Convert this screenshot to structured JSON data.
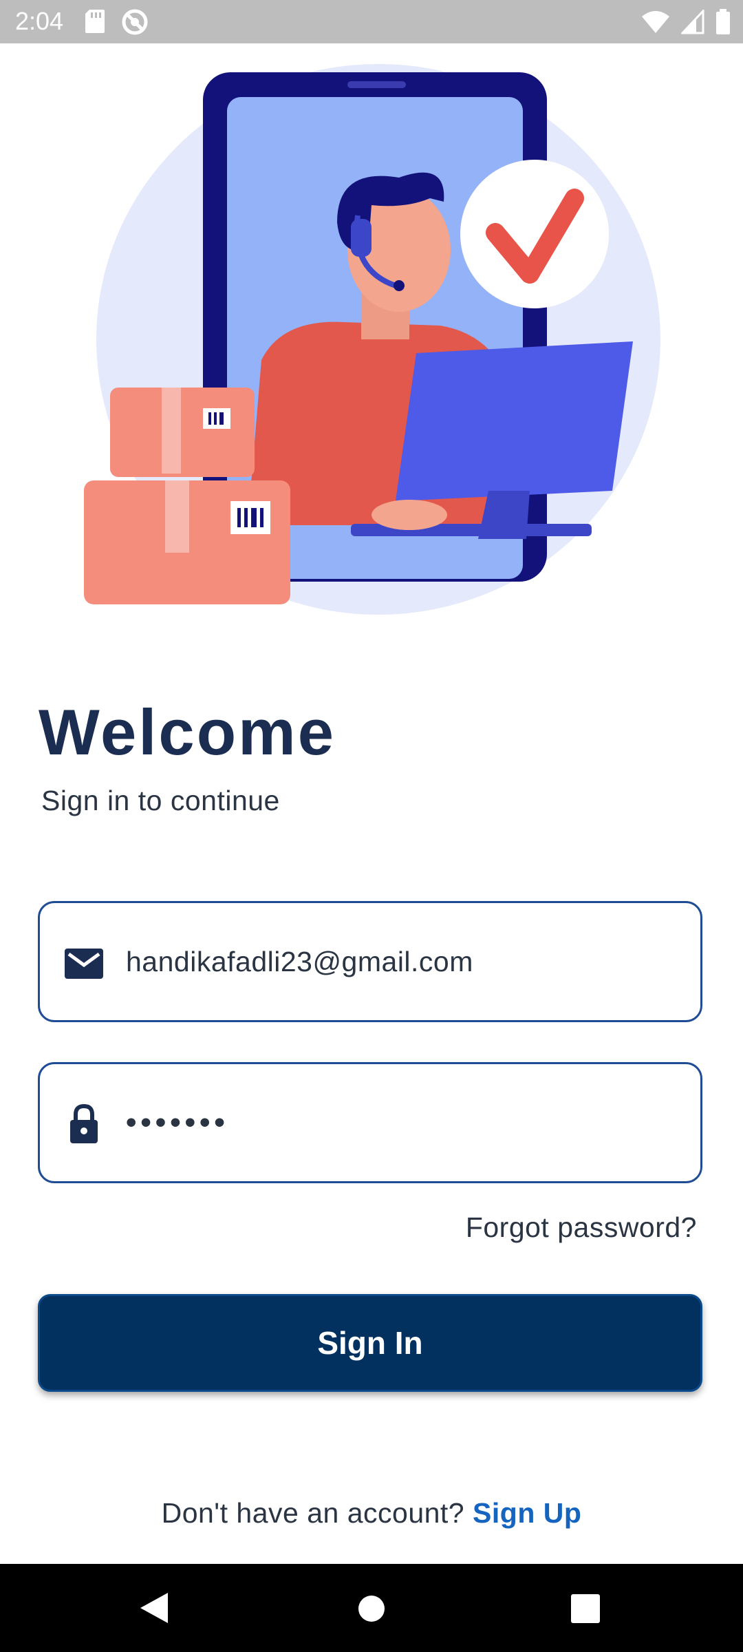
{
  "status_bar": {
    "time": "2:04",
    "icons_left": [
      "sd-card-icon",
      "do-not-disturb-icon"
    ],
    "icons_right": [
      "wifi-icon",
      "cell-signal-icon",
      "battery-icon"
    ]
  },
  "welcome": {
    "title": "Welcome",
    "subtitle": "Sign in to continue"
  },
  "email_field": {
    "icon": "mail-icon",
    "value": "handikafadli23@gmail.com"
  },
  "password_field": {
    "icon": "lock-icon",
    "value": "•••••••"
  },
  "forgot_password": "Forgot password?",
  "sign_in_button": "Sign In",
  "signup": {
    "prompt": "Don't have an account?",
    "link": "Sign Up"
  },
  "nav_bar": {
    "icons": [
      "back-icon",
      "home-icon",
      "recents-icon"
    ]
  },
  "colors": {
    "primary": "#03315f",
    "link": "#1565c0",
    "field_border": "#1f4d95",
    "title": "#1b2d50"
  }
}
